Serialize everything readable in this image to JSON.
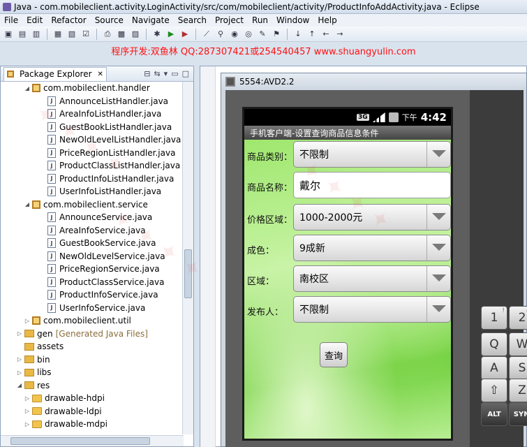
{
  "window": {
    "title": "Java - com.mobileclient.activity.LoginActivity/src/com/mobileclient/activity/ProductInfoAddActivity.java - Eclipse"
  },
  "menu": [
    "File",
    "Edit",
    "Refactor",
    "Source",
    "Navigate",
    "Search",
    "Project",
    "Run",
    "Window",
    "Help"
  ],
  "banner": {
    "text": "程序开发:双鱼林 QQ:287307421或254540457 www.shuangyulin.com",
    "color": "#ff1010"
  },
  "package_explorer": {
    "tab_label": "Package Explorer",
    "tree": [
      {
        "indent": 3,
        "type": "package",
        "label": "com.mobileclient.handler",
        "expanded": true
      },
      {
        "indent": 5,
        "type": "java",
        "label": "AnnounceListHandler.java"
      },
      {
        "indent": 5,
        "type": "java",
        "label": "AreaInfoListHandler.java"
      },
      {
        "indent": 5,
        "type": "java",
        "label": "GuestBookListHandler.java"
      },
      {
        "indent": 5,
        "type": "java",
        "label": "NewOldLevelListHandler.java"
      },
      {
        "indent": 5,
        "type": "java",
        "label": "PriceRegionListHandler.java"
      },
      {
        "indent": 5,
        "type": "java",
        "label": "ProductClassListHandler.java"
      },
      {
        "indent": 5,
        "type": "java",
        "label": "ProductInfoListHandler.java"
      },
      {
        "indent": 5,
        "type": "java",
        "label": "UserInfoListHandler.java"
      },
      {
        "indent": 3,
        "type": "package",
        "label": "com.mobileclient.service",
        "expanded": true
      },
      {
        "indent": 5,
        "type": "java",
        "label": "AnnounceService.java"
      },
      {
        "indent": 5,
        "type": "java",
        "label": "AreaInfoService.java"
      },
      {
        "indent": 5,
        "type": "java",
        "label": "GuestBookService.java"
      },
      {
        "indent": 5,
        "type": "java",
        "label": "NewOldLevelService.java"
      },
      {
        "indent": 5,
        "type": "java",
        "label": "PriceRegionService.java"
      },
      {
        "indent": 5,
        "type": "java",
        "label": "ProductClassService.java"
      },
      {
        "indent": 5,
        "type": "java",
        "label": "ProductInfoService.java"
      },
      {
        "indent": 5,
        "type": "java",
        "label": "UserInfoService.java"
      },
      {
        "indent": 3,
        "type": "package",
        "label": "com.mobileclient.util",
        "expanded": false
      },
      {
        "indent": 2,
        "type": "folder",
        "label": "gen",
        "suffix": "[Generated Java Files]",
        "expanded": false
      },
      {
        "indent": 2,
        "type": "folder",
        "label": "assets"
      },
      {
        "indent": 2,
        "type": "folder",
        "label": "bin",
        "expanded": false
      },
      {
        "indent": 2,
        "type": "folder",
        "label": "libs",
        "expanded": false
      },
      {
        "indent": 2,
        "type": "folder",
        "label": "res",
        "expanded": true
      },
      {
        "indent": 3,
        "type": "folder",
        "label": "drawable-hdpi",
        "expanded": false
      },
      {
        "indent": 3,
        "type": "folder",
        "label": "drawable-ldpi",
        "expanded": false
      },
      {
        "indent": 3,
        "type": "folder",
        "label": "drawable-mdpi",
        "expanded": false
      }
    ]
  },
  "emulator": {
    "title": "5554:AVD2.2",
    "status": {
      "network": "3G",
      "time_prefix": "下午",
      "time": "4:42"
    },
    "app_title": "手机客户端-设置查询商品信息条件",
    "form": [
      {
        "label": "商品类别：",
        "value": "不限制",
        "kind": "spinner"
      },
      {
        "label": "商品名称：",
        "value": "戴尔",
        "kind": "text"
      },
      {
        "label": "价格区域：",
        "value": "1000-2000元",
        "kind": "spinner"
      },
      {
        "label": "成色：",
        "value": "9成新",
        "kind": "spinner"
      },
      {
        "label": "区域：",
        "value": "南校区",
        "kind": "spinner"
      },
      {
        "label": "发布人：",
        "value": "不限制",
        "kind": "spinner"
      }
    ],
    "query_button": "查询",
    "keyboard": [
      {
        "label": "1",
        "sub": "!"
      },
      {
        "label": "2",
        "sub": "@"
      },
      {
        "label": "Q",
        "sub": ""
      },
      {
        "label": "W",
        "sub": ""
      },
      {
        "label": "A",
        "sub": ""
      },
      {
        "label": "S",
        "sub": ""
      },
      {
        "label": "⇧",
        "sub": ""
      },
      {
        "label": "Z",
        "sub": ""
      },
      {
        "label": "ALT",
        "sub": ""
      },
      {
        "label": "SYM",
        "sub": ""
      }
    ]
  }
}
